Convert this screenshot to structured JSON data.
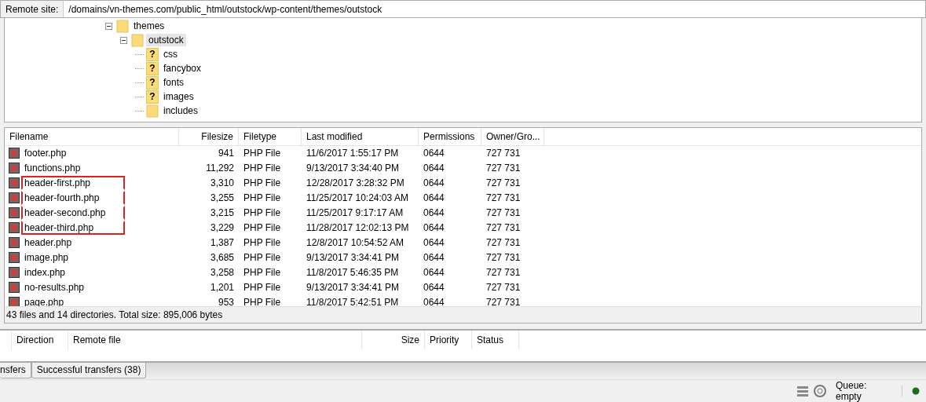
{
  "remote_site": {
    "label": "Remote site:",
    "path": "/domains/vn-themes.com/public_html/outstock/wp-content/themes/outstock"
  },
  "tree": [
    {
      "label": "themes",
      "expanded": true,
      "selected": false,
      "children": [
        {
          "label": "outstock",
          "expanded": true,
          "selected": true,
          "children": [
            {
              "label": "css",
              "badge": "?"
            },
            {
              "label": "fancybox",
              "badge": "?"
            },
            {
              "label": "fonts",
              "badge": "?"
            },
            {
              "label": "images",
              "badge": "?"
            },
            {
              "label": "includes"
            }
          ]
        }
      ]
    }
  ],
  "file_list": {
    "columns": [
      "Filename",
      "Filesize",
      "Filetype",
      "Last modified",
      "Permissions",
      "Owner/Gro..."
    ],
    "rows": [
      {
        "cells": [
          "footer.php",
          "941",
          "PHP File",
          "11/6/2017 1:55:17 PM",
          "0644",
          "727 731"
        ],
        "marked": false
      },
      {
        "cells": [
          "functions.php",
          "11,292",
          "PHP File",
          "9/13/2017 3:34:40 PM",
          "0644",
          "727 731"
        ],
        "marked": false
      },
      {
        "cells": [
          "header-first.php",
          "3,310",
          "PHP File",
          "12/28/2017 3:28:32 PM",
          "0644",
          "727 731"
        ],
        "marked": true
      },
      {
        "cells": [
          "header-fourth.php",
          "3,255",
          "PHP File",
          "11/25/2017 10:24:03 AM",
          "0644",
          "727 731"
        ],
        "marked": true
      },
      {
        "cells": [
          "header-second.php",
          "3,215",
          "PHP File",
          "11/25/2017 9:17:17 AM",
          "0644",
          "727 731"
        ],
        "marked": true
      },
      {
        "cells": [
          "header-third.php",
          "3,229",
          "PHP File",
          "11/28/2017 12:02:13 PM",
          "0644",
          "727 731"
        ],
        "marked": true
      },
      {
        "cells": [
          "header.php",
          "1,387",
          "PHP File",
          "12/8/2017 10:54:52 AM",
          "0644",
          "727 731"
        ],
        "marked": false
      },
      {
        "cells": [
          "image.php",
          "3,685",
          "PHP File",
          "9/13/2017 3:34:41 PM",
          "0644",
          "727 731"
        ],
        "marked": false
      },
      {
        "cells": [
          "index.php",
          "3,258",
          "PHP File",
          "11/8/2017 5:46:35 PM",
          "0644",
          "727 731"
        ],
        "marked": false
      },
      {
        "cells": [
          "no-results.php",
          "1,201",
          "PHP File",
          "9/13/2017 3:34:41 PM",
          "0644",
          "727 731"
        ],
        "marked": false
      },
      {
        "cells": [
          "page.php",
          "953",
          "PHP File",
          "11/8/2017 5:42:51 PM",
          "0644",
          "727 731"
        ],
        "marked": false
      }
    ],
    "summary": "43 files and 14 directories. Total size: 895,006 bytes"
  },
  "queue": {
    "columns": [
      "Direction",
      "Remote file",
      "Size",
      "Priority",
      "Status"
    ]
  },
  "tabs": [
    {
      "label": "nsfers",
      "selected": false
    },
    {
      "label": "Successful transfers (38)",
      "selected": false
    }
  ],
  "status_bar": {
    "queue": "Queue: empty"
  }
}
